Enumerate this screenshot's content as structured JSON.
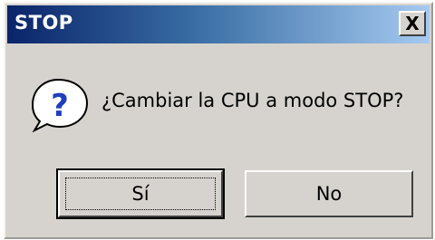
{
  "window": {
    "title": "STOP",
    "close_glyph": "X"
  },
  "dialog": {
    "icon": "question-icon",
    "icon_glyph": "?",
    "message": "¿Cambiar la CPU a modo STOP?"
  },
  "buttons": {
    "yes_label": "Sí",
    "no_label": "No"
  },
  "colors": {
    "face": "#d6d3ce",
    "title_start": "#0a246a",
    "title_end": "#a6caf0",
    "icon_blue": "#1f3fbf"
  }
}
